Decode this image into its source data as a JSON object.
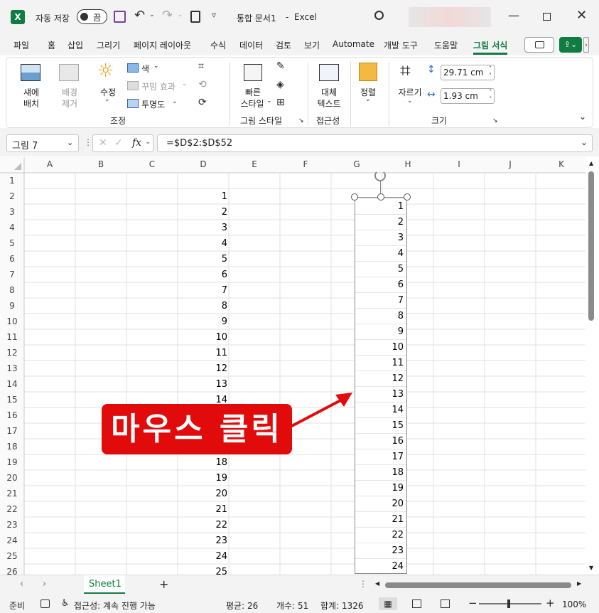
{
  "titlebar": {
    "autosave_label": "자동 저장",
    "toggle_label": "끔",
    "doc_title": "통합 문서1",
    "separator": "-",
    "app_name": "Excel"
  },
  "tabs": [
    "파일",
    "홈",
    "삽입",
    "그리기",
    "페이지 레이아웃",
    "수식",
    "데이터",
    "검토",
    "보기",
    "Automate",
    "개발 도구",
    "도움말",
    "그림 서식"
  ],
  "active_tab": "그림 서식",
  "ribbon": {
    "remove_bg": "섀에\n배치",
    "remove_bg_l1": "섀에",
    "remove_bg_l2": "배치",
    "bg_l1": "배경",
    "bg_l2": "제거",
    "corrections": "수정",
    "color": "색",
    "artistic": "꾸밈 효과",
    "transparency": "투명도",
    "adjust_group": "조정",
    "quick_styles_l1": "빠른",
    "quick_styles_l2": "스타일",
    "styles_group": "그림 스타일",
    "alt_text_l1": "대체",
    "alt_text_l2": "텍스트",
    "accessibility_group": "접근성",
    "arrange": "정렬",
    "crop": "자르기",
    "height_value": "29.71 cm",
    "width_value": "1.93 cm",
    "size_group": "크기"
  },
  "formula": {
    "namebox": "그림 7",
    "fx": "fx",
    "formula_text": "=$D$2:$D$52"
  },
  "columns": [
    "A",
    "B",
    "C",
    "D",
    "E",
    "F",
    "G",
    "H",
    "I",
    "J",
    "K"
  ],
  "rows": [
    "1",
    "2",
    "3",
    "4",
    "5",
    "6",
    "7",
    "8",
    "9",
    "10",
    "11",
    "12",
    "13",
    "14",
    "15",
    "16",
    "17",
    "18",
    "19",
    "20",
    "21",
    "22",
    "23",
    "24",
    "25",
    "26"
  ],
  "column_d_values": [
    "1",
    "2",
    "3",
    "4",
    "5",
    "6",
    "7",
    "8",
    "9",
    "10",
    "11",
    "12",
    "13",
    "14",
    "18",
    "19",
    "20",
    "21",
    "22",
    "23",
    "24",
    "25"
  ],
  "picture_values": [
    "1",
    "2",
    "3",
    "4",
    "5",
    "6",
    "7",
    "8",
    "9",
    "10",
    "11",
    "12",
    "13",
    "14",
    "15",
    "16",
    "17",
    "18",
    "19",
    "20",
    "21",
    "22",
    "23",
    "24"
  ],
  "callout_text": "마우스 클릭",
  "colors": {
    "accent": "#107c41",
    "callout": "#e10b0b"
  },
  "sheet": {
    "tab_name": "Sheet1",
    "add": "+"
  },
  "status": {
    "ready": "준비",
    "accessibility": "접근성: 계속 진행 가능",
    "average": "평균: 26",
    "count": "개수: 51",
    "sum": "합계: 1326",
    "zoom": "100%"
  }
}
